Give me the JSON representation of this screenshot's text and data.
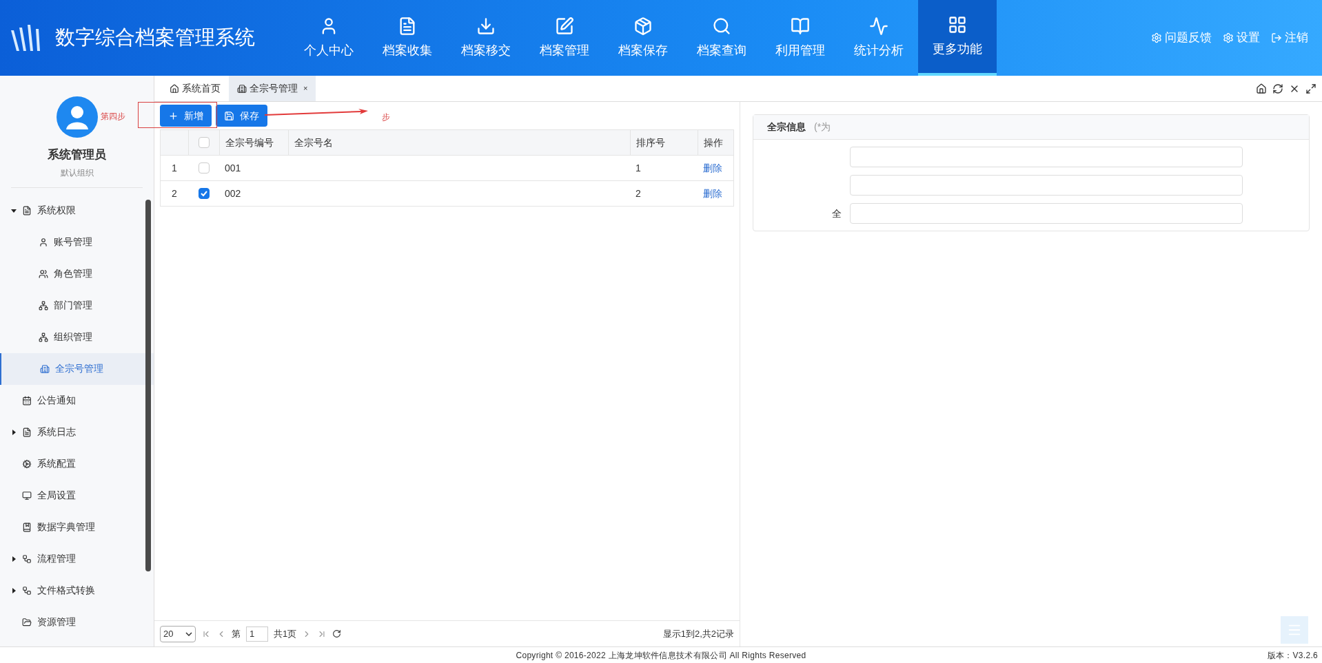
{
  "header": {
    "title": "数字综合档案管理系统",
    "nav": [
      {
        "label": "个人中心",
        "selected": false
      },
      {
        "label": "档案收集",
        "selected": false
      },
      {
        "label": "档案移交",
        "selected": false
      },
      {
        "label": "档案管理",
        "selected": false
      },
      {
        "label": "档案保存",
        "selected": false
      },
      {
        "label": "档案查询",
        "selected": false
      },
      {
        "label": "利用管理",
        "selected": false
      },
      {
        "label": "统计分析",
        "selected": false
      },
      {
        "label": "更多功能",
        "selected": true
      }
    ],
    "actions": [
      "问题反馈",
      "设置",
      "注销"
    ]
  },
  "user": {
    "name": "系统管理员",
    "org": "默认组织"
  },
  "sidebar": {
    "items": [
      {
        "label": "系统权限",
        "kind": "group",
        "expanded": true,
        "selected": false,
        "children": [
          {
            "label": "账号管理",
            "selected": false
          },
          {
            "label": "角色管理",
            "selected": false
          },
          {
            "label": "部门管理",
            "selected": false
          },
          {
            "label": "组织管理",
            "selected": false
          },
          {
            "label": "全宗号管理",
            "selected": true
          }
        ]
      },
      {
        "label": "公告通知",
        "kind": "leaf",
        "selected": false
      },
      {
        "label": "系统日志",
        "kind": "group",
        "expanded": false,
        "selected": false
      },
      {
        "label": "系统配置",
        "kind": "leaf",
        "selected": false
      },
      {
        "label": "全局设置",
        "kind": "leaf",
        "selected": false
      },
      {
        "label": "数据字典管理",
        "kind": "leaf",
        "selected": false
      },
      {
        "label": "流程管理",
        "kind": "group",
        "expanded": false,
        "selected": false
      },
      {
        "label": "文件格式转换",
        "kind": "group",
        "expanded": false,
        "selected": false
      },
      {
        "label": "资源管理",
        "kind": "leaf",
        "selected": false
      }
    ]
  },
  "tabs": [
    {
      "label": "系统首页",
      "selected": false
    },
    {
      "label": "全宗号管理",
      "selected": true,
      "close": "×"
    }
  ],
  "toolbar": {
    "buttons": [
      "新增",
      "保存"
    ],
    "annotation": "第四步",
    "annotation_tail": "步"
  },
  "table": {
    "columns": [
      "全宗号编号",
      "全宗号名",
      "排序号",
      "操作"
    ],
    "all_checked": false,
    "rows": [
      {
        "index": "1",
        "selected": false,
        "code": "001",
        "order": "1",
        "action": "删除"
      },
      {
        "index": "2",
        "selected": true,
        "code": "002",
        "order": "2",
        "action": "删除"
      }
    ]
  },
  "pager": {
    "page_size": "20",
    "page_prefix": "第",
    "page": "1",
    "total_pages": "共1页",
    "summary": "显示1到2,共2记录"
  },
  "form": {
    "title": "全宗信息",
    "hint": "(*为",
    "fields": [
      {
        "kind": "text"
      },
      {
        "kind": "text"
      },
      {
        "kind": "text",
        "label": "全"
      }
    ]
  },
  "footer": {
    "copyright": "Copyright © 2016-2022 上海龙坤软件信息技术有限公司 All Rights Reserved",
    "version": "版本：V3.2.6"
  }
}
